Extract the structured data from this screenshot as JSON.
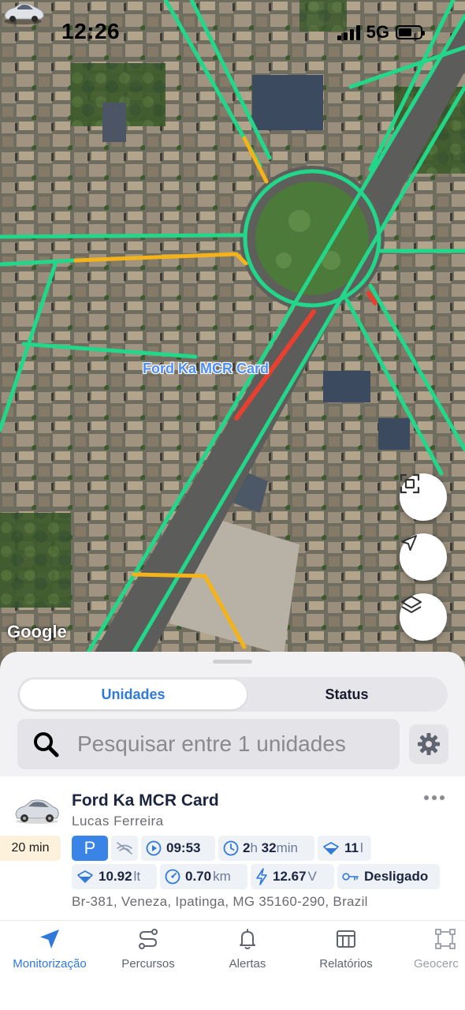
{
  "status_bar": {
    "time": "12:26",
    "network": "5G"
  },
  "map": {
    "vehicle_label": "Ford Ka MCR Card",
    "attribution": "Google",
    "buttons": [
      {
        "name": "fit-bounds-button",
        "icon": "focus-frame-icon"
      },
      {
        "name": "my-location-button",
        "icon": "navigation-arrow-icon"
      },
      {
        "name": "map-layers-button",
        "icon": "layers-icon"
      }
    ],
    "colors": {
      "traffic_free": "#22d68a",
      "traffic_slow": "#f5b31a",
      "traffic_heavy": "#e8402e"
    }
  },
  "tabs_segment": {
    "active": "Unidades",
    "inactive": "Status"
  },
  "search": {
    "placeholder": "Pesquisar entre 1 unidades"
  },
  "unit": {
    "name": "Ford Ka MCR Card",
    "driver": "Lucas Ferreira",
    "elapsed": "20 min",
    "parking": "P",
    "trip_time": "09:53",
    "duration_hours": "2",
    "duration_hours_unit": "h",
    "duration_minutes": "32",
    "duration_minutes_unit": "min",
    "fuel_level": "11",
    "fuel_level_unit": "l",
    "fuel_consumed": "10.92",
    "fuel_consumed_unit": "lt",
    "speed": "0.70",
    "speed_unit": "km",
    "voltage": "12.67",
    "voltage_unit": "V",
    "ignition": "Desligado",
    "address": "Br-381, Veneza, Ipatinga, MG 35160-290, Brazil"
  },
  "tabbar": {
    "items": [
      {
        "label": "Monitorização",
        "icon": "navigation-arrow-icon",
        "active": true
      },
      {
        "label": "Percursos",
        "icon": "route-icon",
        "active": false
      },
      {
        "label": "Alertas",
        "icon": "bell-icon",
        "active": false
      },
      {
        "label": "Relatórios",
        "icon": "report-table-icon",
        "active": false
      },
      {
        "label": "Geocerc",
        "icon": "geofence-icon",
        "active": false
      }
    ]
  },
  "colors": {
    "accent": "#2f7ad8",
    "parking_badge": "#3a84e8",
    "time_badge_bg": "#fdf1dc"
  }
}
